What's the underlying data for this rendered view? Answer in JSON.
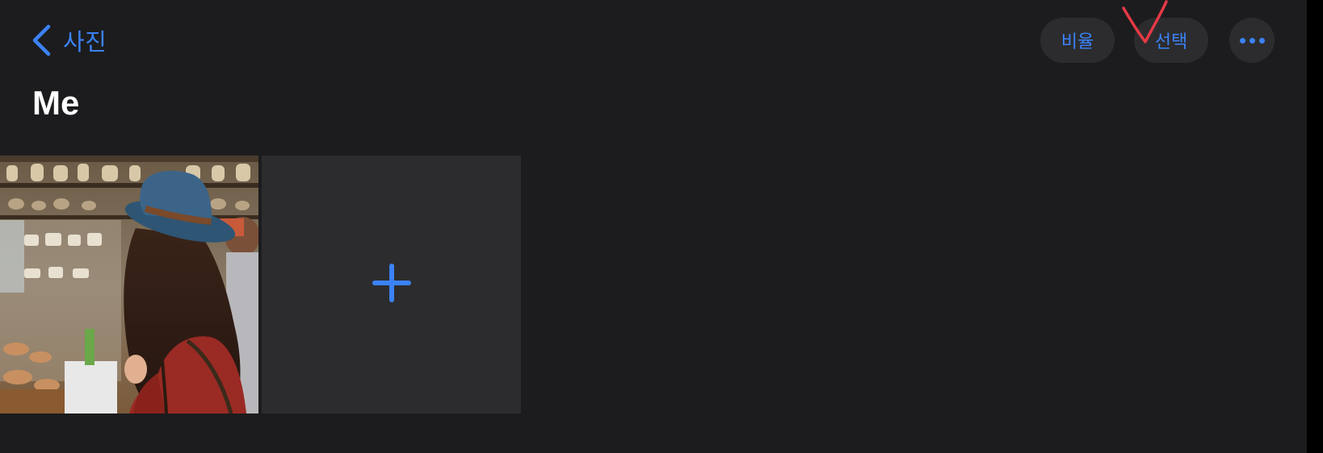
{
  "nav": {
    "back_label": "사진",
    "ratio_label": "비율",
    "select_label": "선택",
    "more_icon": "ellipsis-icon"
  },
  "page": {
    "title": "Me"
  },
  "grid": {
    "items": [
      {
        "type": "photo",
        "description_icon": "photo-thumbnail"
      },
      {
        "type": "add",
        "icon": "plus-icon"
      }
    ]
  },
  "colors": {
    "accent": "#3b82f6",
    "background": "#1c1c1e",
    "pill": "#2c2c2e",
    "annotation": "#e53946"
  }
}
